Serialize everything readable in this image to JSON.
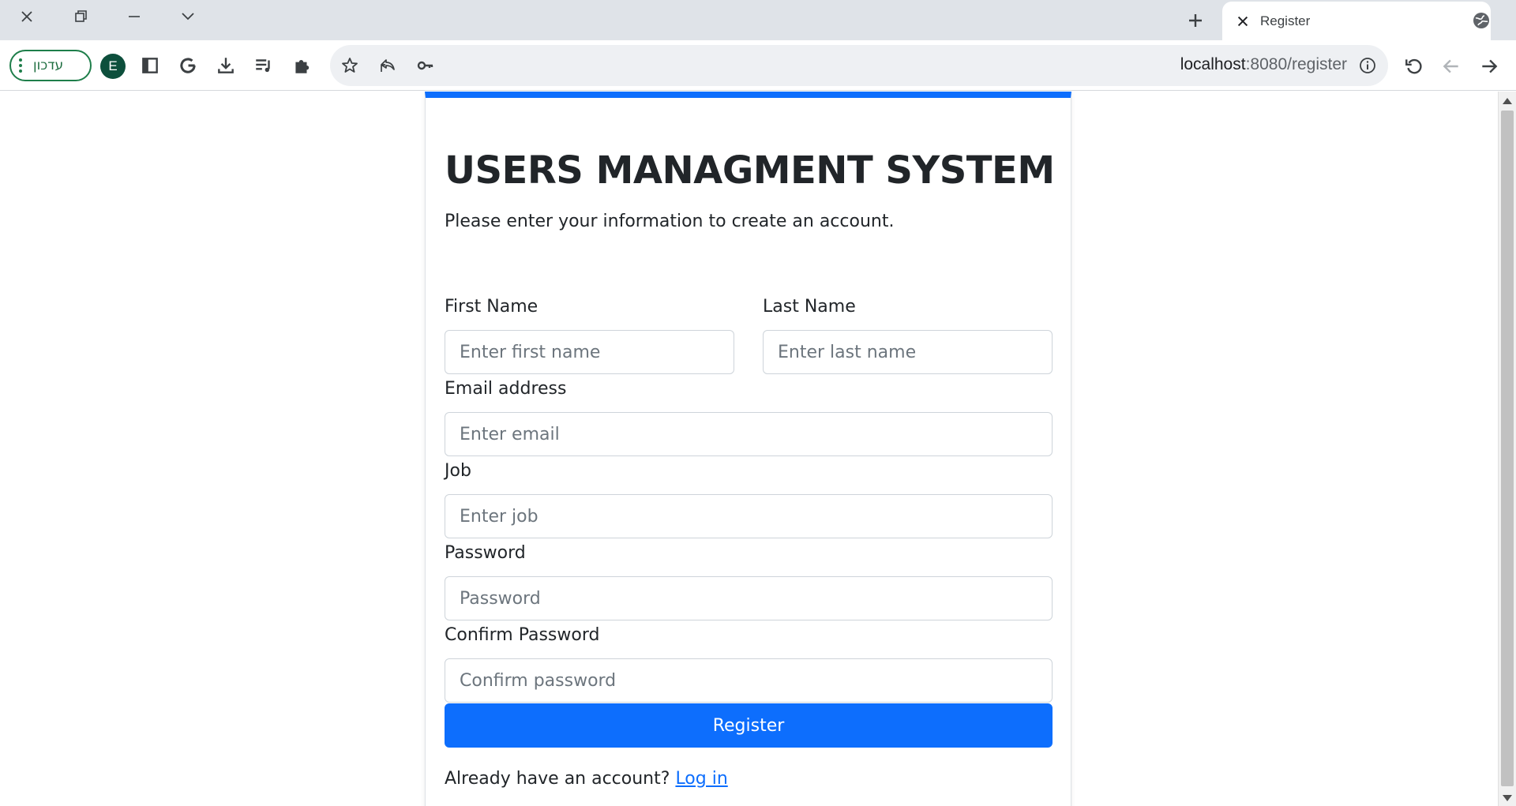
{
  "browser": {
    "tab_title": "Register",
    "url_host": "localhost",
    "url_path": ":8080/register",
    "update_button_label": "עדכון",
    "profile_initial": "E"
  },
  "page": {
    "title": "USERS MANAGMENT SYSTEM",
    "subtitle": "Please enter your information to create an account.",
    "form": {
      "first_name": {
        "label": "First Name",
        "placeholder": "Enter first name"
      },
      "last_name": {
        "label": "Last Name",
        "placeholder": "Enter last name"
      },
      "email": {
        "label": "Email address",
        "placeholder": "Enter email"
      },
      "job": {
        "label": "Job",
        "placeholder": "Enter job"
      },
      "password": {
        "label": "Password",
        "placeholder": "Password"
      },
      "confirm_password": {
        "label": "Confirm Password",
        "placeholder": "Confirm password"
      },
      "submit_label": "Register"
    },
    "footer": {
      "text": "Already have an account?",
      "link_label": "Log in"
    }
  },
  "colors": {
    "primary": "#0d6efd",
    "text": "#212529",
    "update_green": "#1e7e4a"
  }
}
